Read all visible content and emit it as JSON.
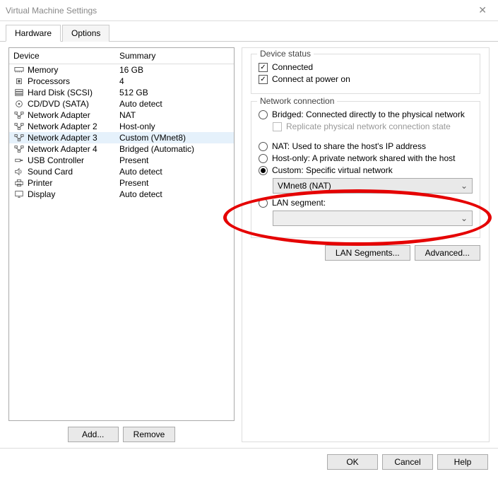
{
  "window": {
    "title": "Virtual Machine Settings"
  },
  "tabs": [
    {
      "label": "Hardware",
      "active": true
    },
    {
      "label": "Options",
      "active": false
    }
  ],
  "device_list": {
    "headers": {
      "device": "Device",
      "summary": "Summary"
    },
    "items": [
      {
        "icon": "memory",
        "name": "Memory",
        "summary": "16 GB"
      },
      {
        "icon": "cpu",
        "name": "Processors",
        "summary": "4"
      },
      {
        "icon": "disk",
        "name": "Hard Disk (SCSI)",
        "summary": "512 GB"
      },
      {
        "icon": "cd",
        "name": "CD/DVD (SATA)",
        "summary": "Auto detect"
      },
      {
        "icon": "net",
        "name": "Network Adapter",
        "summary": "NAT"
      },
      {
        "icon": "net",
        "name": "Network Adapter 2",
        "summary": "Host-only"
      },
      {
        "icon": "net",
        "name": "Network Adapter 3",
        "summary": "Custom (VMnet8)",
        "selected": true
      },
      {
        "icon": "net",
        "name": "Network Adapter 4",
        "summary": "Bridged (Automatic)"
      },
      {
        "icon": "usb",
        "name": "USB Controller",
        "summary": "Present"
      },
      {
        "icon": "sound",
        "name": "Sound Card",
        "summary": "Auto detect"
      },
      {
        "icon": "printer",
        "name": "Printer",
        "summary": "Present"
      },
      {
        "icon": "display",
        "name": "Display",
        "summary": "Auto detect"
      }
    ]
  },
  "left_buttons": {
    "add": "Add...",
    "remove": "Remove"
  },
  "device_status": {
    "legend": "Device status",
    "connected": {
      "label": "Connected",
      "checked": true
    },
    "connect_power": {
      "label": "Connect at power on",
      "checked": true
    }
  },
  "network_connection": {
    "legend": "Network connection",
    "bridged": {
      "label": "Bridged: Connected directly to the physical network"
    },
    "replicate": {
      "label": "Replicate physical network connection state"
    },
    "nat": {
      "label": "NAT: Used to share the host's IP address"
    },
    "hostonly": {
      "label": "Host-only: A private network shared with the host"
    },
    "custom": {
      "label": "Custom: Specific virtual network",
      "selected": true
    },
    "custom_value": "VMnet8 (NAT)",
    "lan_segment": {
      "label": "LAN segment:"
    },
    "buttons": {
      "lan_segments": "LAN Segments...",
      "advanced": "Advanced..."
    }
  },
  "footer": {
    "ok": "OK",
    "cancel": "Cancel",
    "help": "Help"
  }
}
